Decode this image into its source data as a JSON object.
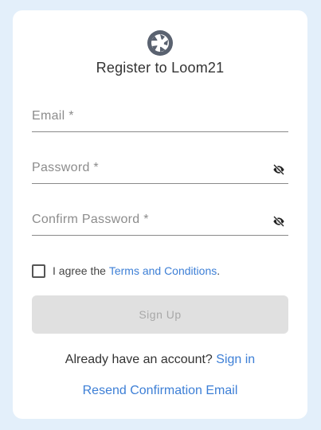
{
  "brand": {
    "logo_icon": "aperture-logo-icon",
    "title": "Register to Loom21"
  },
  "form": {
    "email_label": "Email *",
    "password_label": "Password *",
    "confirm_password_label": "Confirm Password *",
    "visibility_icon": "eye-slash-icon",
    "agree_prefix": "I agree the ",
    "terms_link": "Terms and Conditions",
    "agree_suffix": ".",
    "terms_checked": false,
    "signup_label": "Sign Up",
    "signup_enabled": false
  },
  "footer": {
    "already_text": "Already have an account?",
    "signin_link": "Sign in",
    "resend_link": "Resend Confirmation Email"
  },
  "colors": {
    "page_background": "#e3effa",
    "card_background": "#ffffff",
    "link": "#3d7fd6",
    "disabled_button": "#e0e0e0",
    "logo": "#5a6270"
  }
}
